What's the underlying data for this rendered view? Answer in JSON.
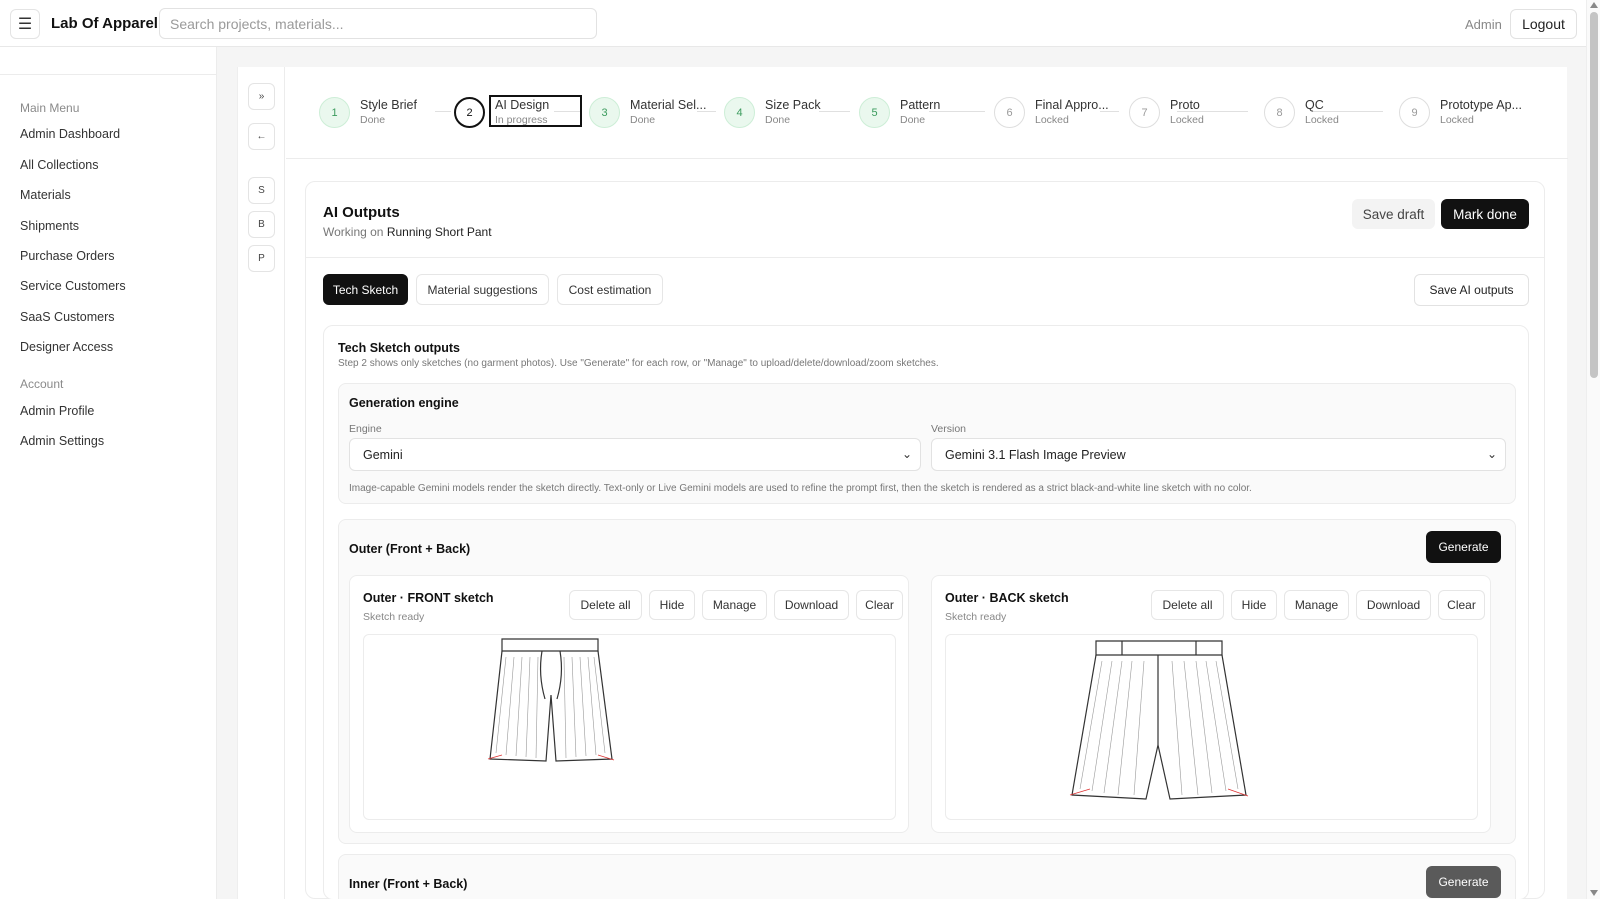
{
  "header": {
    "menu_icon": "hamburger-icon",
    "brand": "Lab Of Apparel",
    "search_placeholder": "Search projects, materials...",
    "user": "Admin",
    "logout_label": "Logout"
  },
  "sidebar": {
    "section_main": "Main Menu",
    "main_items": [
      "Admin Dashboard",
      "All Collections",
      "Materials",
      "Shipments",
      "Purchase Orders",
      "Service Customers",
      "SaaS Customers",
      "Designer Access"
    ],
    "section_account": "Account",
    "account_items": [
      "Admin Profile",
      "Admin Settings"
    ]
  },
  "mini_nav": {
    "expand": "»",
    "back": "←",
    "items": [
      "S",
      "B",
      "P"
    ]
  },
  "stepper": {
    "steps": [
      {
        "num": "1",
        "title": "Style Brief",
        "status": "Done",
        "state": "done"
      },
      {
        "num": "2",
        "title": "AI Design",
        "status": "In progress",
        "state": "active"
      },
      {
        "num": "3",
        "title": "Material Sel...",
        "status": "Done",
        "state": "done"
      },
      {
        "num": "4",
        "title": "Size Pack",
        "status": "Done",
        "state": "done"
      },
      {
        "num": "5",
        "title": "Pattern",
        "status": "Done",
        "state": "done"
      },
      {
        "num": "6",
        "title": "Final Appro...",
        "status": "Locked",
        "state": "locked"
      },
      {
        "num": "7",
        "title": "Proto",
        "status": "Locked",
        "state": "locked"
      },
      {
        "num": "8",
        "title": "QC",
        "status": "Locked",
        "state": "locked"
      },
      {
        "num": "9",
        "title": "Prototype Ap...",
        "status": "Locked",
        "state": "locked"
      }
    ]
  },
  "card": {
    "title": "AI Outputs",
    "sub_prefix": "Working on",
    "project": "Running Short Pant",
    "save_draft": "Save draft",
    "mark_done": "Mark done",
    "tabs": [
      "Tech Sketch",
      "Material suggestions",
      "Cost estimation"
    ],
    "save_ai": "Save AI outputs"
  },
  "tech_sketch": {
    "title": "Tech Sketch outputs",
    "desc": "Step 2 shows only sketches (no garment photos). Use \"Generate\" for each row, or \"Manage\" to upload/delete/download/zoom sketches.",
    "engine_section": "Generation engine",
    "engine_label": "Engine",
    "engine_value": "Gemini",
    "version_label": "Version",
    "version_value": "Gemini 3.1 Flash Image Preview",
    "engine_note": "Image-capable Gemini models render the sketch directly. Text-only or Live Gemini models are used to refine the prompt first, then the sketch is rendered as a strict black-and-white line sketch with no color.",
    "outer_title": "Outer (Front + Back)",
    "generate": "Generate",
    "front_title": "Outer · FRONT sketch",
    "back_title": "Outer · BACK sketch",
    "sketch_status": "Sketch ready",
    "actions": [
      "Delete all",
      "Hide",
      "Manage",
      "Download",
      "Clear"
    ],
    "inner_title": "Inner (Front + Back)"
  }
}
